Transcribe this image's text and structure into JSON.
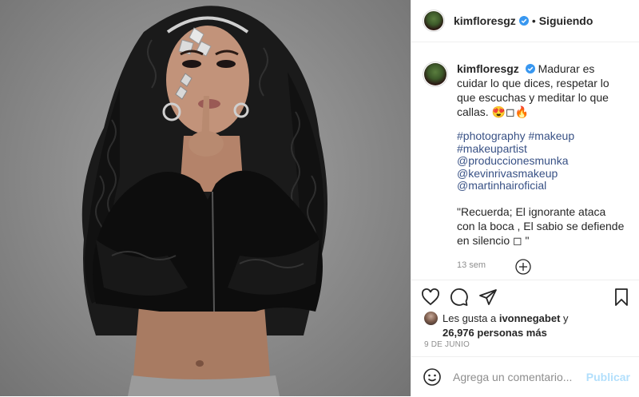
{
  "post": {
    "username": "kimfloresgz",
    "follow_status": "Siguiendo",
    "separator": "•",
    "caption": {
      "username": "kimfloresgz",
      "text": "Madurar es cuidar lo que dices, respetar lo que escuchas y meditar lo que callas. 😍◻🔥",
      "tags": [
        "#photography #makeup",
        "#makeupartist",
        "@produccionesmunka",
        "@kevinrivasmakeup",
        "@martinhairoficial"
      ],
      "quote": "\"Recuerda; El ignorante ataca con la boca , El sabio se defiende en silencio ◻ \"",
      "time_ago": "13 sem"
    },
    "likes": {
      "prefix": "Les gusta a ",
      "first_user": "ivonnegabet",
      "conjunction": " y",
      "others": "26,976 personas más"
    },
    "date": "9 DE JUNIO",
    "comment_placeholder": "Agrega un comentario...",
    "publish_label": "Publicar",
    "colors": {
      "verified": "#3897f0",
      "link": "#3b5998",
      "publish_disabled": "#b2dffc"
    },
    "icons": [
      "heart-icon",
      "comment-icon",
      "share-icon",
      "bookmark-icon",
      "emoji-icon",
      "load-more-icon",
      "verified-badge-icon"
    ]
  }
}
